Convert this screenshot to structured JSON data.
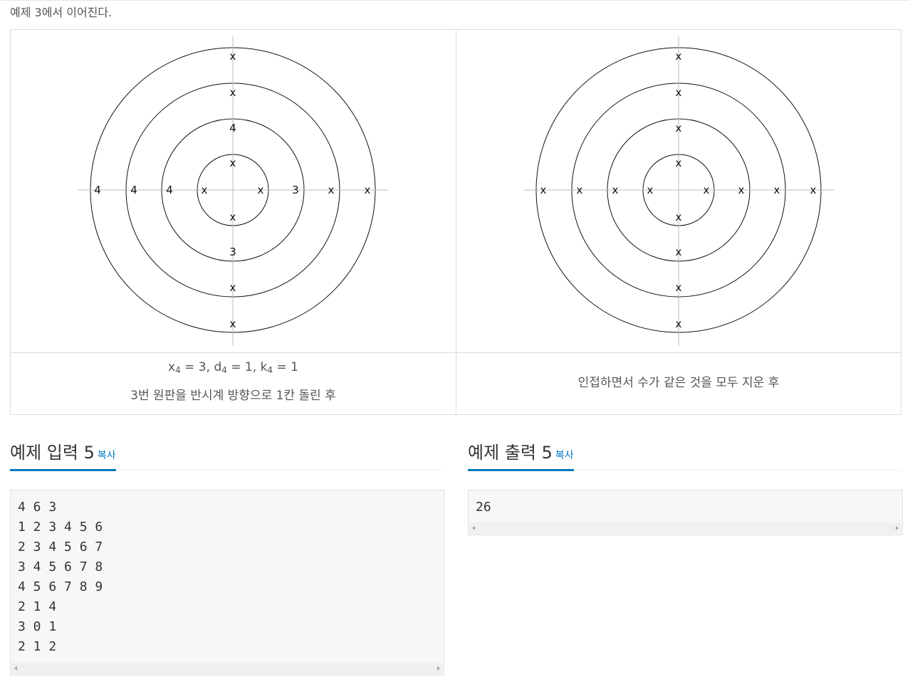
{
  "intro": "예제 3에서 이어진다.",
  "figures": [
    {
      "labels": {
        "top": [
          "x",
          "4",
          "x",
          "x"
        ],
        "bottom": [
          "x",
          "3",
          "x",
          "x"
        ],
        "left": [
          "4",
          "4",
          "4",
          "x"
        ],
        "right": [
          "x",
          "3",
          "x",
          "x"
        ]
      },
      "caption": {
        "formula": {
          "x": "x",
          "x_sub": "4",
          "x_val": " = 3, ",
          "d": "d",
          "d_sub": "4",
          "d_val": " = 1, ",
          "k": "k",
          "k_sub": "4",
          "k_val": " = 1"
        },
        "text": "3번 원판을 반시계 방향으로 1칸 돌린 후"
      }
    },
    {
      "labels": {
        "top": [
          "x",
          "x",
          "x",
          "x"
        ],
        "bottom": [
          "x",
          "x",
          "x",
          "x"
        ],
        "left": [
          "x",
          "x",
          "x",
          "x"
        ],
        "right": [
          "x",
          "x",
          "x",
          "x"
        ]
      },
      "caption": {
        "text": "인접하면서 수가 같은 것을 모두 지운 후"
      }
    }
  ],
  "sample_input": {
    "title": "예제 입력 5",
    "copy_label": "복사",
    "lines": [
      "4 6 3",
      "1 2 3 4 5 6",
      "2 3 4 5 6 7",
      "3 4 5 6 7 8",
      "4 5 6 7 8 9",
      "2 1 4",
      "3 0 1",
      "2 1 2"
    ]
  },
  "sample_output": {
    "title": "예제 출력 5",
    "copy_label": "복사",
    "lines": [
      "26"
    ]
  },
  "colors": {
    "accent": "#0076c0",
    "code_bg": "#f7f7f9",
    "border": "#dddddd"
  }
}
